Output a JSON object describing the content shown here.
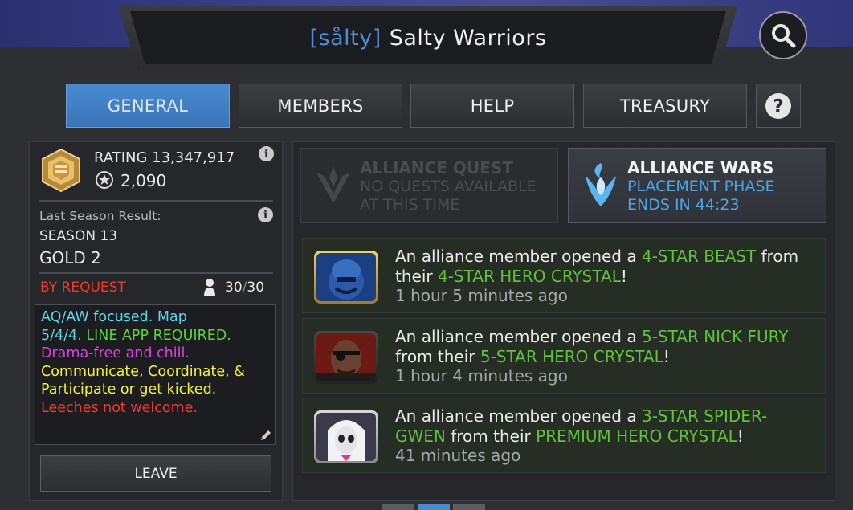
{
  "header": {
    "alliance_tag": "[sålty]",
    "alliance_name": "Salty Warriors"
  },
  "tabs": [
    {
      "label": "GENERAL",
      "active": true
    },
    {
      "label": "MEMBERS",
      "active": false
    },
    {
      "label": "HELP",
      "active": false
    },
    {
      "label": "TREASURY",
      "active": false
    }
  ],
  "help_icon": "question-icon",
  "summary": {
    "rating_label": "RATING",
    "rating_value": "13,347,917",
    "prestige_value": "2,090",
    "last_season_label": "Last Season Result:",
    "season": "SEASON 13",
    "tier": "GOLD 2",
    "join_type": "BY REQUEST",
    "members_current": "30",
    "members_separator": "/",
    "members_max": "30",
    "description_lines": [
      {
        "text": "AQ/AW focused. Map",
        "color": "#5fd6e6"
      },
      {
        "text": "5/4/4.",
        "color": "#5fd6e6"
      },
      {
        "text": " LINE APP REQUIRED.",
        "color": "#5fd23a"
      },
      {
        "text": "Drama-free and chill.",
        "color": "#e040e0"
      },
      {
        "text": "Communicate, Coordinate, &",
        "color": "#f4f040"
      },
      {
        "text": "Participate or get kicked.",
        "color": "#f4f040"
      },
      {
        "text": "Leeches not welcome.",
        "color": "#ef3a2a"
      }
    ],
    "leave_label": "LEAVE"
  },
  "modes": {
    "quest": {
      "title": "ALLIANCE QUEST",
      "line1": "NO QUESTS AVAILABLE",
      "line2": "AT THIS TIME"
    },
    "wars": {
      "title": "ALLIANCE WARS",
      "line1": "PLACEMENT PHASE",
      "line2": "ENDS IN 44:23"
    }
  },
  "feed": [
    {
      "prefix": "An alliance member opened a ",
      "hero": "4-STAR BEAST",
      "middle": " from",
      "line2_prefix": "their ",
      "crystal": "4-STAR HERO CRYSTAL",
      "suffix": "!",
      "time": "1 hour 5 minutes ago",
      "portrait": "beast-portrait"
    },
    {
      "prefix": "An alliance member opened a ",
      "hero": "5-STAR NICK FURY",
      "middle": "",
      "line2_prefix": "from their ",
      "crystal": "5-STAR HERO CRYSTAL",
      "suffix": "!",
      "time": "1 hour 4 minutes ago",
      "portrait": "nick-fury-portrait"
    },
    {
      "prefix": "An alliance member opened a ",
      "hero": "3-STAR SPIDER-",
      "hero_cont": "GWEN",
      "line2_prefix": " from their ",
      "crystal": "PREMIUM HERO CRYSTAL",
      "suffix": "!",
      "time": "41 minutes ago",
      "portrait": "spider-gwen-portrait"
    }
  ],
  "colors": {
    "accent_blue": "#4f8fd6",
    "highlight_green": "#5fc23a",
    "request_red": "#ef3a2a",
    "wars_blue": "#4aa6e8"
  }
}
